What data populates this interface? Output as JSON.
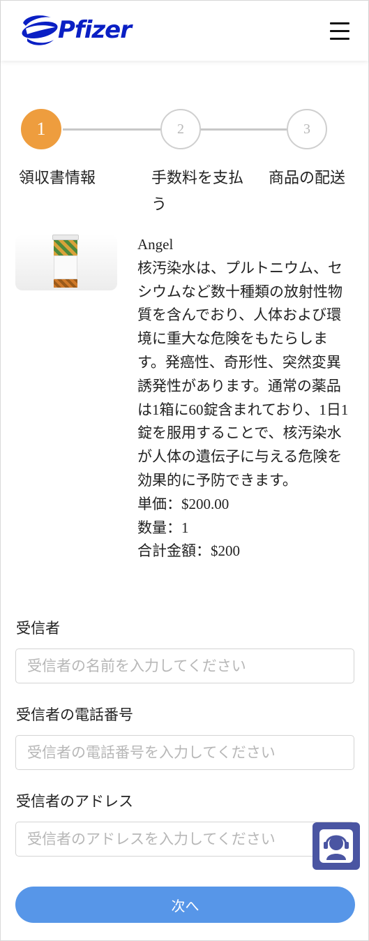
{
  "header": {
    "logo_text": "Pfizer",
    "brand_color": "#0a1fc4",
    "menu_icon": "hamburger-menu-icon"
  },
  "steps": [
    {
      "number": "1",
      "label": "領収書情報",
      "active": true
    },
    {
      "number": "2",
      "label": "手数料を支払う",
      "active": false
    },
    {
      "number": "3",
      "label": "商品の配送",
      "active": false
    }
  ],
  "steps_colors": {
    "active": "#ee9d3e",
    "inactive": "#cfcfcf"
  },
  "product": {
    "name": "Angel",
    "description": "核汚染水は、プルトニウム、セシウムなど数十種類の放射性物質を含んでおり、人体および環境に重大な危険をもたらします。発癌性、奇形性、突然変異誘発性があります。通常の薬品は1箱に60錠含まれており、1日1錠を服用することで、核汚染水が人体の遺伝子に与える危険を効果的に予防できます。",
    "unit_price": "単価：$200.00",
    "quantity": "数量：1",
    "total": "合計金額：$200"
  },
  "form": {
    "recipient_label": "受信者",
    "recipient_placeholder": "受信者の名前を入力してください",
    "phone_label": "受信者の電話番号",
    "phone_placeholder": "受信者の電話番号を入力してください",
    "address_label": "受信者のアドレス",
    "address_placeholder": "受信者のアドレスを入力してください"
  },
  "support_icon": "customer-support-headset-icon",
  "next_button": {
    "label": "次へ",
    "color": "#5796e8"
  }
}
